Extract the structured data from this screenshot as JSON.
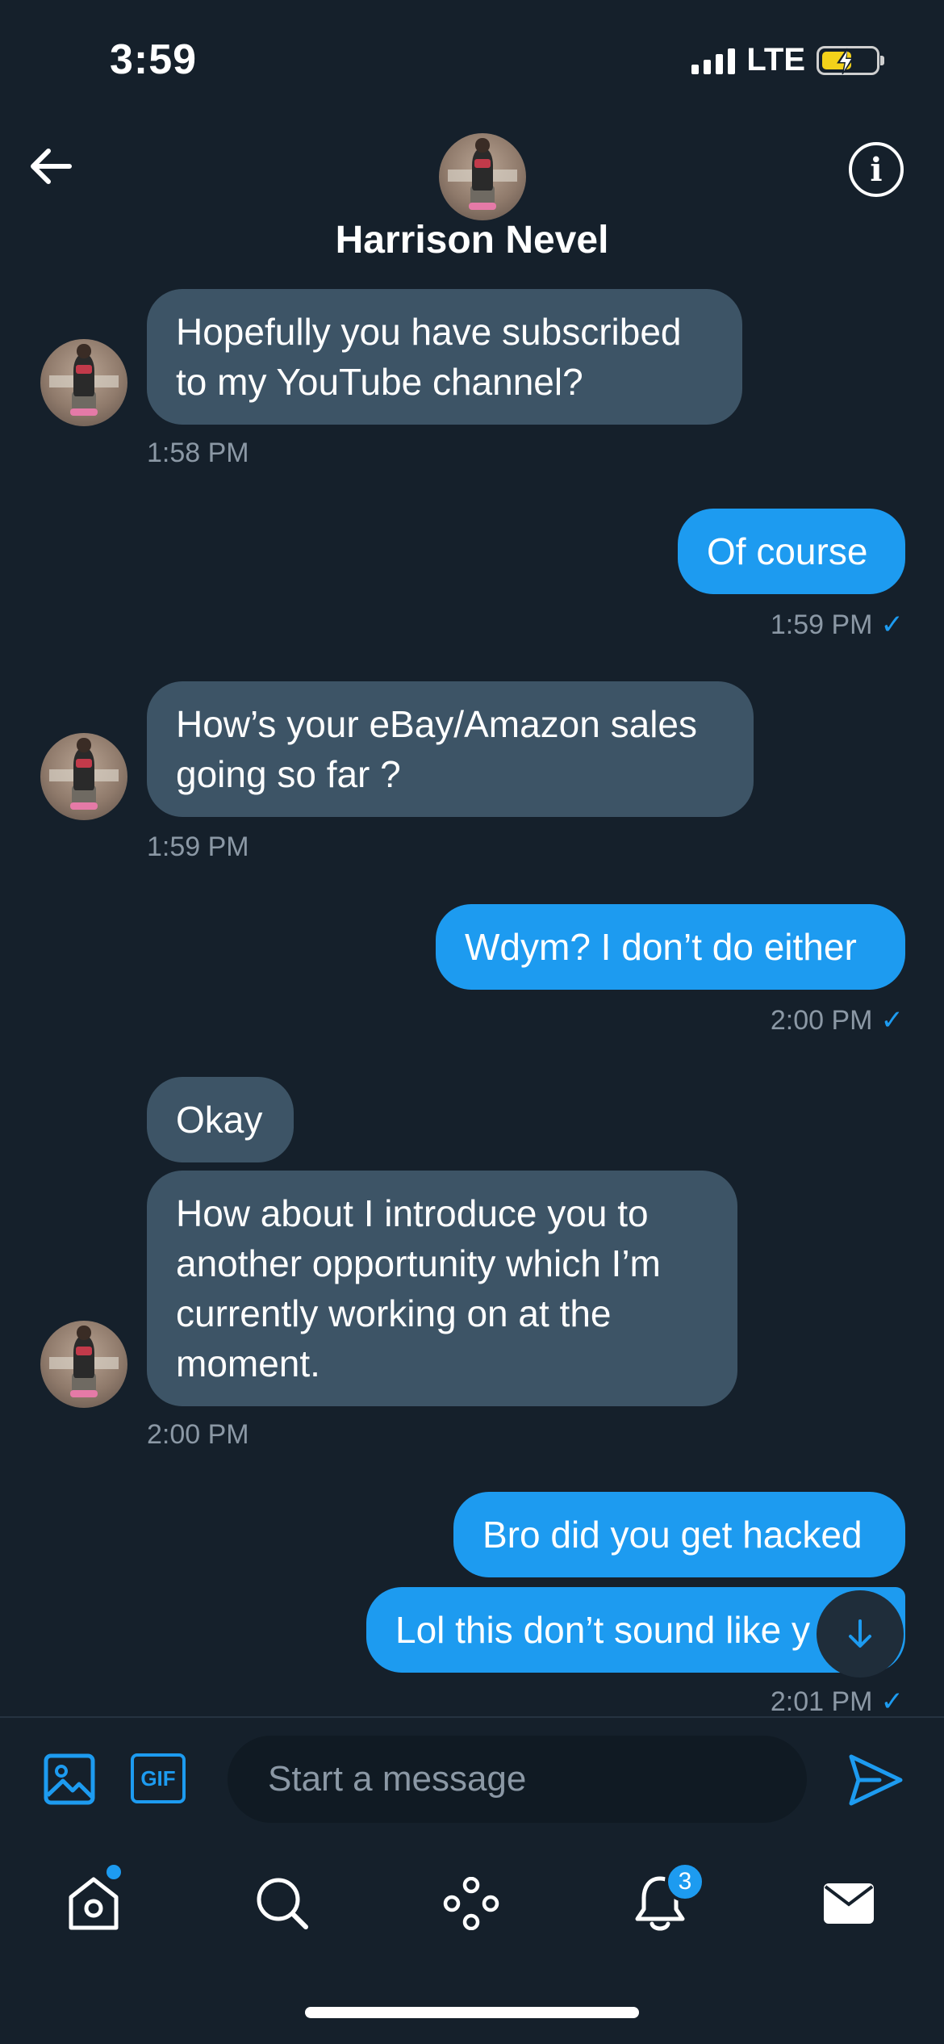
{
  "status_bar": {
    "time": "3:59",
    "network": "LTE"
  },
  "header": {
    "contact_name": "Harrison Nevel"
  },
  "messages": [
    {
      "dir": "in",
      "text": "Hopefully you have subscribed to my YouTube channel?",
      "time": "1:58 PM"
    },
    {
      "dir": "out",
      "text": "Of course",
      "time": "1:59 PM"
    },
    {
      "dir": "in",
      "text": "How’s your eBay/Amazon sales going so far ?",
      "time": "1:59 PM"
    },
    {
      "dir": "out",
      "text": "Wdym? I don’t do either",
      "time": "2:00 PM"
    },
    {
      "dir": "in",
      "text": "Okay"
    },
    {
      "dir": "in",
      "text": "How about I introduce you to another opportunity which I’m currently working on at the moment.",
      "time": "2:00 PM"
    },
    {
      "dir": "out",
      "text": "Bro did you get hacked"
    },
    {
      "dir": "out",
      "text": "Lol this don’t sound like y",
      "time": "2:01 PM"
    }
  ],
  "read_check": "✓",
  "composer": {
    "placeholder": "Start a message",
    "gif_label": "GIF"
  },
  "nav": {
    "notifications_count": "3"
  },
  "colors": {
    "background": "#15202b",
    "accent": "#1d9bf0",
    "incoming_bubble": "#3d5466"
  },
  "icons": [
    "back-arrow-icon",
    "info-icon",
    "image-icon",
    "gif-icon",
    "send-icon",
    "home-icon",
    "search-icon",
    "spaces-icon",
    "bell-icon",
    "mail-icon",
    "arrow-down-icon"
  ]
}
